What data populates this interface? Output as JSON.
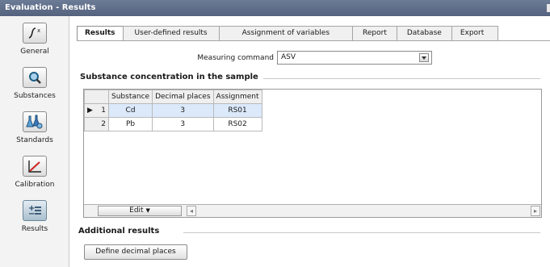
{
  "window": {
    "title": "Evaluation - Results"
  },
  "sidebar": {
    "items": [
      {
        "label": "General",
        "icon": "function-graph-icon"
      },
      {
        "label": "Substances",
        "icon": "magnifier-icon"
      },
      {
        "label": "Standards",
        "icon": "flasks-icon"
      },
      {
        "label": "Calibration",
        "icon": "calibration-curve-icon"
      },
      {
        "label": "Results",
        "icon": "plus-minus-list-icon"
      }
    ],
    "active": "Results"
  },
  "tabs": [
    "Results",
    "User-defined results",
    "Assignment of variables",
    "Report",
    "Database",
    "Export"
  ],
  "active_tab": "Results",
  "measuring_command": {
    "label": "Measuring command",
    "value": "ASV"
  },
  "substance_section": {
    "title": "Substance concentration in the sample",
    "columns": [
      "Substance",
      "Decimal places",
      "Assignment"
    ],
    "rows": [
      {
        "num": "1",
        "substance": "Cd",
        "decimal_places": "3",
        "assignment": "RS01"
      },
      {
        "num": "2",
        "substance": "Pb",
        "decimal_places": "3",
        "assignment": "RS02"
      }
    ],
    "edit_label": "Edit"
  },
  "additional_section": {
    "title": "Additional results",
    "button": "Define decimal places"
  },
  "colors": {
    "titlebar": "#5d6b87",
    "selection": "#dbe9fb",
    "accent_red": "#cc2222"
  }
}
